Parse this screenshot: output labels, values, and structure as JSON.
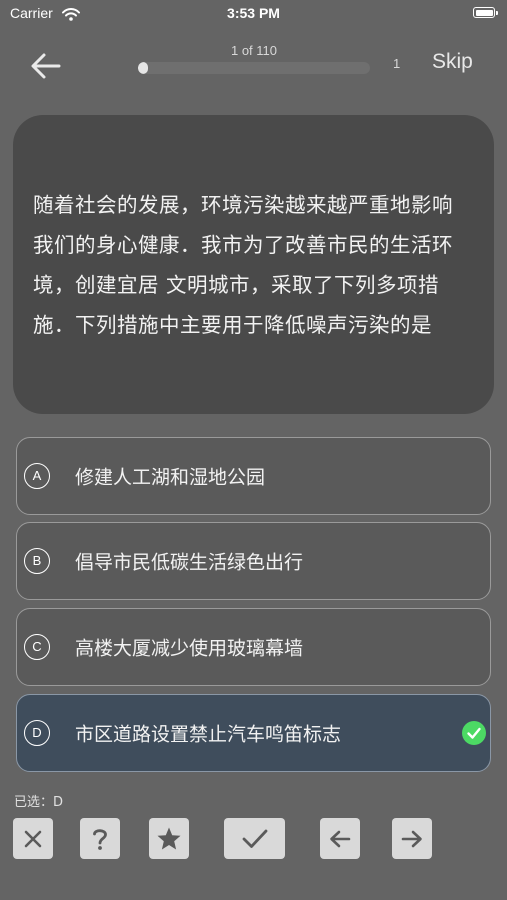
{
  "status_bar": {
    "carrier": "Carrier",
    "time": "3:53 PM",
    "icons": [
      "wifi-icon",
      "battery-icon"
    ]
  },
  "header": {
    "back_icon": "arrow-left-icon",
    "progress_label": "1 of 110",
    "progress_fraction": 0.0091,
    "counter": "1",
    "skip_label": "Skip"
  },
  "question": {
    "text": "随着社会的发展，环境污染越来越严重地影响我们的身心健康．我市为了改善市民的生活环境，创建宜居 文明城市，采取了下列多项措施．下列措施中主要用于降低噪声污染的是"
  },
  "options": [
    {
      "letter": "A",
      "text": "修建人工湖和湿地公园",
      "selected": false
    },
    {
      "letter": "B",
      "text": "倡导市民低碳生活绿色出行",
      "selected": false
    },
    {
      "letter": "C",
      "text": "高楼大厦减少使用玻璃幕墙",
      "selected": false
    },
    {
      "letter": "D",
      "text": "市区道路设置禁止汽车鸣笛标志",
      "selected": true
    }
  ],
  "selected_label": "已选：D",
  "toolbar": {
    "buttons": [
      "close-icon",
      "help-icon",
      "star-icon",
      "checkmark-icon",
      "arrow-left-icon",
      "arrow-right-icon"
    ]
  },
  "colors": {
    "background": "#646464",
    "card": "#4a4a4a",
    "selected_option": "#3f4d5c",
    "check": "#4cd964",
    "toolbar_button": "#d9d9d9"
  }
}
